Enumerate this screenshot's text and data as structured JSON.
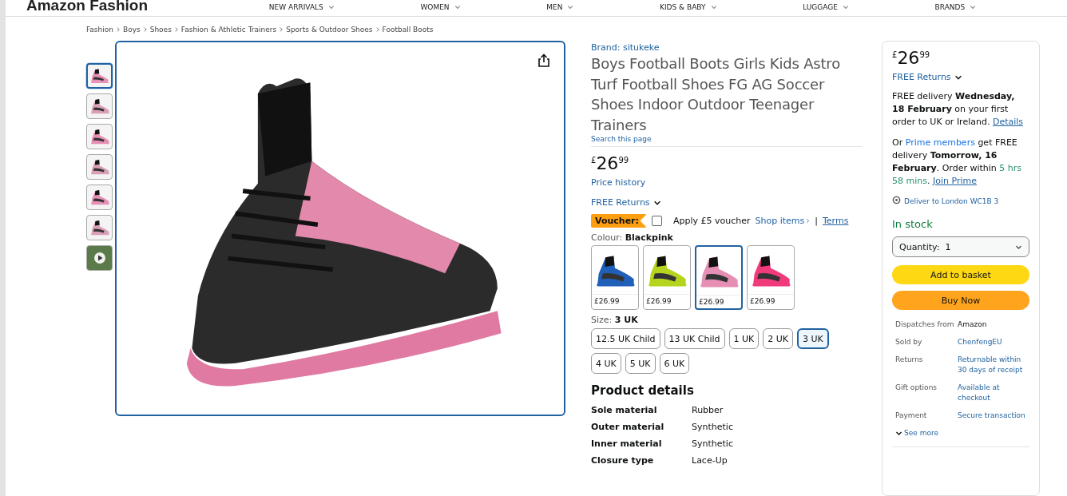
{
  "header": {
    "logo": "Amazon Fashion",
    "nav": [
      "NEW ARRIVALS",
      "WOMEN",
      "MEN",
      "KIDS & BABY",
      "LUGGAGE",
      "BRANDS"
    ]
  },
  "breadcrumb": [
    "Fashion",
    "Boys",
    "Shoes",
    "Fashion & Athletic Trainers",
    "Sports & Outdoor Shoes",
    "Football Boots"
  ],
  "gallery": {
    "thumbnails": [
      {
        "kind": "image",
        "selected": true
      },
      {
        "kind": "image",
        "selected": false
      },
      {
        "kind": "image",
        "selected": false
      },
      {
        "kind": "image",
        "selected": false
      },
      {
        "kind": "image",
        "selected": false
      },
      {
        "kind": "image",
        "selected": false
      },
      {
        "kind": "video",
        "selected": false
      }
    ]
  },
  "product": {
    "brand": "Brand: situkeke",
    "title": "Boys Football Boots Girls Kids Astro Turf Football Shoes FG AG Soccer Shoes Indoor Outdoor Teenager Trainers",
    "search_link": "Search this page",
    "price": {
      "currency": "£",
      "whole": "26",
      "fraction": "99"
    },
    "price_history": "Price history",
    "free_returns": "FREE Returns",
    "voucher": {
      "badge": "Voucher:",
      "checked": false,
      "label": "Apply £5 voucher",
      "shop_items": "Shop items",
      "separator": "|",
      "terms": "Terms"
    },
    "colour": {
      "label": "Colour:",
      "value": "Blackpink",
      "options": [
        {
          "price": "£26.99",
          "color": "#1f5fb8",
          "selected": false
        },
        {
          "price": "£26.99",
          "color": "#b5d41e",
          "selected": false
        },
        {
          "price": "£26.99",
          "color": "#e58fb4",
          "selected": true
        },
        {
          "price": "£26.99",
          "color": "#f03a7c",
          "selected": false
        }
      ]
    },
    "size": {
      "label": "Size:",
      "value": "3 UK",
      "options": [
        {
          "label": "12.5 UK Child",
          "selected": false
        },
        {
          "label": "13 UK Child",
          "selected": false
        },
        {
          "label": "1 UK",
          "selected": false
        },
        {
          "label": "2 UK",
          "selected": false
        },
        {
          "label": "3 UK",
          "selected": true
        },
        {
          "label": "4 UK",
          "selected": false
        },
        {
          "label": "5 UK",
          "selected": false
        },
        {
          "label": "6 UK",
          "selected": false
        }
      ]
    },
    "details": {
      "heading": "Product details",
      "rows": [
        {
          "label": "Sole material",
          "value": "Rubber"
        },
        {
          "label": "Outer material",
          "value": "Synthetic"
        },
        {
          "label": "Inner material",
          "value": "Synthetic"
        },
        {
          "label": "Closure type",
          "value": "Lace-Up"
        }
      ]
    }
  },
  "buy_box": {
    "price": {
      "currency": "£",
      "whole": "26",
      "fraction": "99"
    },
    "free_returns": "FREE Returns",
    "delivery": [
      {
        "kind": "text",
        "text": "FREE delivery **Wednesday, 18 February** on your first order to UK or Ireland. "
      },
      {
        "kind": "link",
        "text": "Details"
      }
    ],
    "prime": [
      {
        "kind": "text",
        "text": "Or "
      },
      {
        "kind": "highlight",
        "text": "Prime members"
      },
      {
        "kind": "text",
        "text": " get FREE delivery **Tomorrow, 16 February**. Order within "
      },
      {
        "kind": "countdown",
        "text": "5 hrs 58 mins"
      },
      {
        "kind": "text",
        "text": ". "
      },
      {
        "kind": "link",
        "text": "Join Prime"
      }
    ],
    "location": "Deliver to London WC1B 3",
    "stock": "In stock",
    "quantity": {
      "label": "Quantity:",
      "value": "1"
    },
    "add_to_basket": "Add to basket",
    "buy_now": "Buy Now",
    "info": [
      {
        "label": "Dispatches from",
        "value": "Amazon",
        "kind": "text"
      },
      {
        "label": "Sold by",
        "value": "ChenfengEU",
        "kind": "link"
      },
      {
        "label": "Returns",
        "value": "Returnable within 30 days of receipt",
        "kind": "link"
      },
      {
        "label": "Gift options",
        "value": "Available at checkout",
        "kind": "link"
      },
      {
        "label": "Payment",
        "value": "Secure transaction",
        "kind": "link"
      }
    ],
    "see_more": "See more"
  }
}
